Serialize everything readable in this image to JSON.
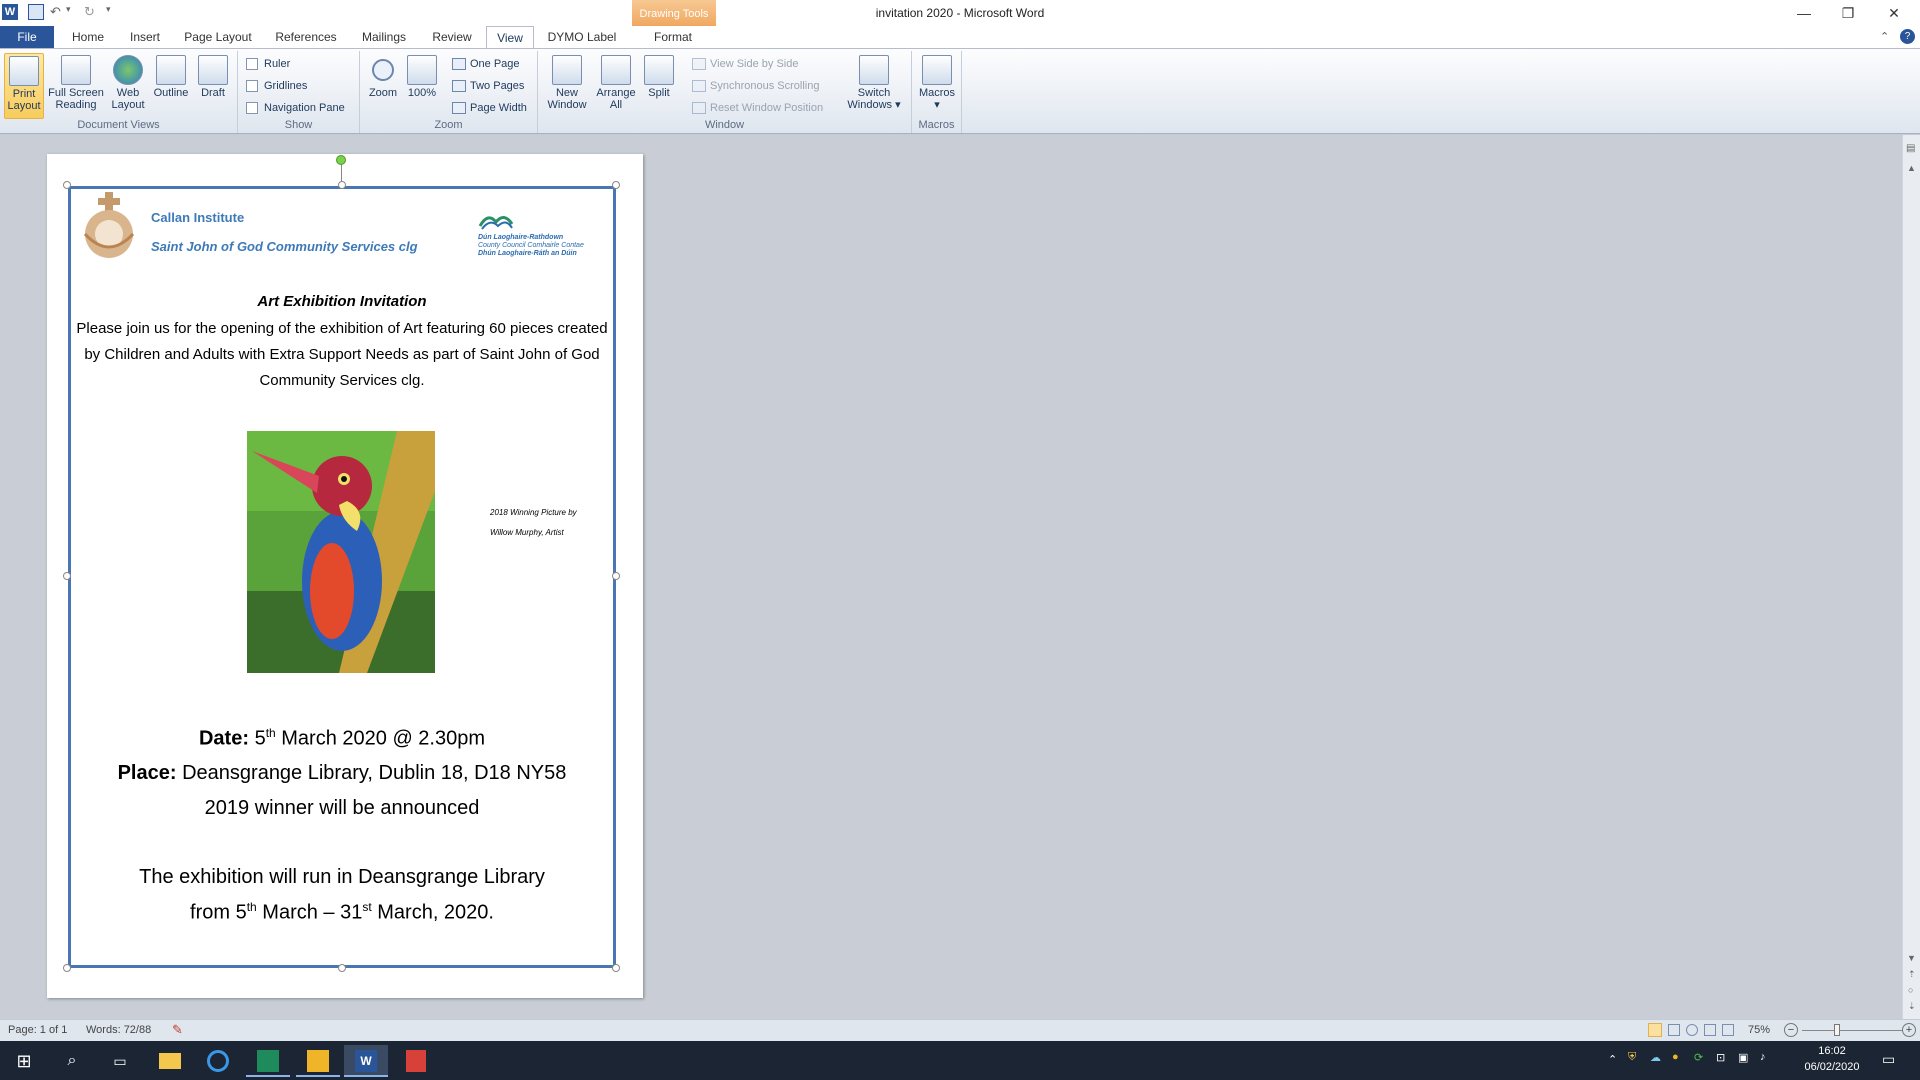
{
  "window": {
    "title": "invitation 2020  -  Microsoft Word",
    "contextual_tab_group": "Drawing Tools",
    "minimize": "—",
    "restore": "❐",
    "close": "✕"
  },
  "tabs": [
    {
      "label": "File"
    },
    {
      "label": "Home"
    },
    {
      "label": "Insert"
    },
    {
      "label": "Page Layout"
    },
    {
      "label": "References"
    },
    {
      "label": "Mailings"
    },
    {
      "label": "Review"
    },
    {
      "label": "View"
    },
    {
      "label": "DYMO Label"
    },
    {
      "label": "Format"
    }
  ],
  "ribbon": {
    "document_views": {
      "group_label": "Document Views",
      "print_layout": "Print Layout",
      "full_screen_reading": "Full Screen Reading",
      "web_layout": "Web Layout",
      "outline": "Outline",
      "draft": "Draft"
    },
    "show": {
      "group_label": "Show",
      "ruler": "Ruler",
      "gridlines": "Gridlines",
      "navigation_pane": "Navigation Pane"
    },
    "zoom": {
      "group_label": "Zoom",
      "zoom": "Zoom",
      "hundred": "100%",
      "one_page": "One Page",
      "two_pages": "Two Pages",
      "page_width": "Page Width"
    },
    "window": {
      "group_label": "Window",
      "new_window": "New Window",
      "arrange_all": "Arrange All",
      "split": "Split",
      "view_side_by_side": "View Side by Side",
      "synchronous_scrolling": "Synchronous Scrolling",
      "reset_window_position": "Reset Window Position",
      "switch_windows": "Switch Windows"
    },
    "macros": {
      "group_label": "Macros",
      "macros": "Macros"
    }
  },
  "document": {
    "org_line1": "Callan Institute",
    "org_line2": "Saint John of God Community Services clg",
    "council_line1": "Dún Laoghaire-Rathdown",
    "council_line2": "County Council Comhairle Contae",
    "council_line3": "Dhún Laoghaire-Ráth an Dúin",
    "heading": "Art Exhibition Invitation",
    "intro": "Please join us for the opening of the exhibition of Art featuring 60 pieces created by Children and Adults with Extra Support Needs as part of Saint John of God Community Services clg.",
    "caption_line1": "2018 Winning Picture by",
    "caption_line2": "Willow Murphy, Artist",
    "date_label": "Date:",
    "date_day": "5",
    "date_sup": "th",
    "date_rest": "March 2020 @ 2.30pm",
    "place_label": "Place:",
    "place_value": "Deansgrange Library, Dublin 18, D18 NY58",
    "winner_line": "2019 winner will be announced",
    "run_line1": "The exhibition will run in Deansgrange Library",
    "run_from": "from 5",
    "run_sup1": "th",
    "run_mid": "March  – 31",
    "run_sup2": "st",
    "run_end": "March,  2020."
  },
  "statusbar": {
    "page": "Page: 1 of 1",
    "words": "Words: 72/88",
    "zoom_level": "75%"
  },
  "taskbar": {
    "time": "16:02",
    "date": "06/02/2020"
  },
  "colors": {
    "accent": "#2a5699",
    "frame": "#4a77b4",
    "drawing_tools": "#f0a860",
    "taskbar": "#1c2533"
  }
}
